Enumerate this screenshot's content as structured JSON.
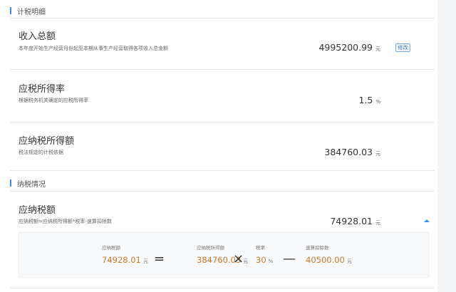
{
  "sections": {
    "tax_detail": "计税明细",
    "tax_status": "纳税情况"
  },
  "income": {
    "title": "收入总额",
    "desc": "本年度开始生产经营月份起至本期从事生产经营取得各项收入总金额",
    "value": "4995200.99",
    "unit": "元",
    "edit_label": "修改"
  },
  "rate": {
    "title": "应税所得率",
    "desc": "根据税务机关确定的应税所得率",
    "value": "1.5",
    "unit": "%"
  },
  "taxable": {
    "title": "应纳税所得额",
    "desc": "税法规定的计税依据",
    "value": "384760.03",
    "unit": "元"
  },
  "tax_payable": {
    "title": "应纳税额",
    "desc": "应纳税额=应纳税所得额*税率-速算扣除数",
    "value": "74928.01",
    "unit": "元"
  },
  "calc": {
    "result": {
      "label": "应纳税额",
      "value": "74928.01",
      "unit": "元"
    },
    "eq": "=",
    "base": {
      "label": "应纳税所得额",
      "value": "384760.03",
      "unit": "元"
    },
    "times": "×",
    "tax_rate": {
      "label": "税率",
      "value": "30",
      "unit": "%"
    },
    "minus": "—",
    "deduction": {
      "label": "速算扣除数",
      "value": "40500.00",
      "unit": "元"
    }
  },
  "colors": {
    "accent": "#3a8ee6",
    "calc_value": "#c97a2a"
  },
  "icons": {
    "collapse": "chevron-up-icon"
  }
}
